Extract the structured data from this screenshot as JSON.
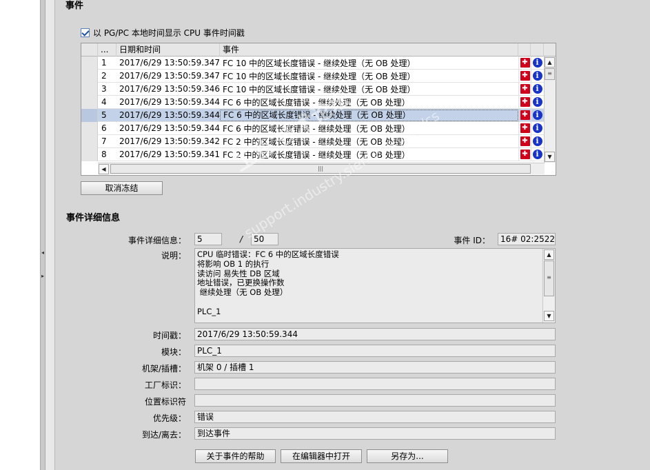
{
  "sections": {
    "events_title": "事件",
    "details_title": "事件详细信息"
  },
  "checkbox": {
    "label": "以 PG/PC 本地时间显示 CPU 事件时间戳",
    "checked": true
  },
  "table": {
    "columns": [
      "...",
      "日期和时间",
      "事件"
    ],
    "rows": [
      {
        "no": "1",
        "datetime": "2017/6/29 13:50:59.347",
        "event": "FC 10 中的区域长度错误 - 继续处理（无 OB 处理）"
      },
      {
        "no": "2",
        "datetime": "2017/6/29 13:50:59.347",
        "event": "FC 10 中的区域长度错误 - 继续处理（无 OB 处理）"
      },
      {
        "no": "3",
        "datetime": "2017/6/29 13:50:59.346",
        "event": "FC 10 中的区域长度错误 - 继续处理（无 OB 处理）"
      },
      {
        "no": "4",
        "datetime": "2017/6/29 13:50:59.344",
        "event": "FC 6 中的区域长度错误 - 继续处理（无 OB 处理）"
      },
      {
        "no": "5",
        "datetime": "2017/6/29 13:50:59.344",
        "event": "FC 6 中的区域长度错误 - 继续处理（无 OB 处理）"
      },
      {
        "no": "6",
        "datetime": "2017/6/29 13:50:59.344",
        "event": "FC 6 中的区域长度错误 - 继续处理（无 OB 处理）"
      },
      {
        "no": "7",
        "datetime": "2017/6/29 13:50:59.342",
        "event": "FC 2 中的区域长度错误 - 继续处理（无 OB 处理）"
      },
      {
        "no": "8",
        "datetime": "2017/6/29 13:50:59.341",
        "event": "FC 2 中的区域长度错误 - 继续处理（无 OB 处理）"
      }
    ],
    "selected_row": 5,
    "row_icons": [
      "tool-icon",
      "info-icon"
    ]
  },
  "freeze_button": "取消冻结",
  "details": {
    "detail_info_label": "事件详细信息：",
    "detail_index": "5",
    "separator": "/",
    "detail_total": "50",
    "event_id_label": "事件 ID：",
    "event_id": "16# 02:2522",
    "description_label": "说明：",
    "description": "CPU 临时错误：FC 6 中的区域长度错误\n将影响 OB 1 的执行\n读访问 易失性 DB 区域\n地址错误，已更换操作数\n 继续处理（无 OB 处理）\n\nPLC_1",
    "timestamp_label": "时间戳：",
    "timestamp": "2017/6/29 13:50:59.344",
    "module_label": "模块：",
    "module": "PLC_1",
    "rack_label": "机架/插槽：",
    "rack": "机架 0 / 插槽 1",
    "plant_label": "工厂标识：",
    "plant": "",
    "location_label": "位置标识符",
    "location": "",
    "priority_label": "优先级：",
    "priority": "错误",
    "direction_label": "到达/离去：",
    "direction": "到达事件"
  },
  "buttons": {
    "help": "关于事件的帮助",
    "open_editor": "在编辑器中打开",
    "save_as": "另存为..."
  },
  "watermark": {
    "line1": "工业 技术论坛",
    "line2": "support.industry.siemens.com/cs"
  },
  "colors": {
    "background": "#d6d6d6",
    "selected_row": "#c3d2e8",
    "error_icon": "#d0021b",
    "info_icon": "#1733c8"
  }
}
